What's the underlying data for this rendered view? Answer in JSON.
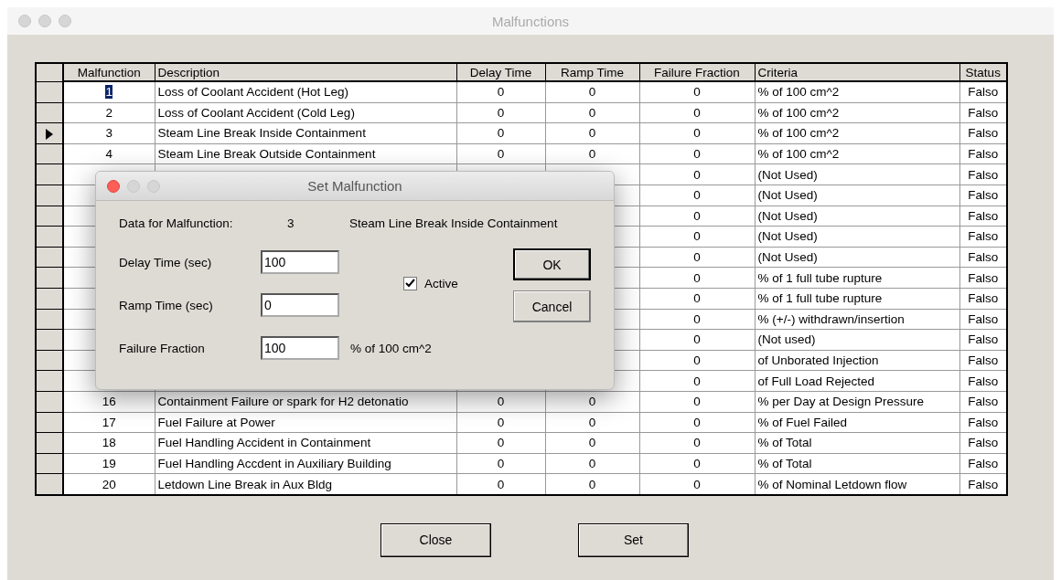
{
  "window": {
    "title": "Malfunctions"
  },
  "table": {
    "columns": [
      "Malfunction",
      "Description",
      "Delay Time",
      "Ramp Time",
      "Failure Fraction",
      "Criteria",
      "Status"
    ],
    "rows": [
      {
        "selected": false,
        "text_highlighted": true,
        "malfunction": "1",
        "description": "Loss of Coolant Accident (Hot Leg)",
        "delay_time": "0",
        "ramp_time": "0",
        "failure_fraction": "0",
        "criteria": "% of 100 cm^2",
        "status": "Falso"
      },
      {
        "selected": false,
        "text_highlighted": false,
        "malfunction": "2",
        "description": "Loss of Coolant Accident (Cold Leg)",
        "delay_time": "0",
        "ramp_time": "0",
        "failure_fraction": "0",
        "criteria": "% of 100 cm^2",
        "status": "Falso"
      },
      {
        "selected": true,
        "text_highlighted": false,
        "malfunction": "3",
        "description": "Steam Line Break Inside Containment",
        "delay_time": "0",
        "ramp_time": "0",
        "failure_fraction": "0",
        "criteria": "% of 100 cm^2",
        "status": "Falso"
      },
      {
        "selected": false,
        "text_highlighted": false,
        "malfunction": "4",
        "description": "Steam Line Break Outside Containment",
        "delay_time": "0",
        "ramp_time": "0",
        "failure_fraction": "0",
        "criteria": "% of 100 cm^2",
        "status": "Falso"
      },
      {
        "selected": false,
        "text_highlighted": false,
        "failure_fraction": "0",
        "criteria": "(Not Used)",
        "status": "Falso"
      },
      {
        "selected": false,
        "text_highlighted": false,
        "failure_fraction": "0",
        "criteria": "(Not Used)",
        "status": "Falso"
      },
      {
        "selected": false,
        "text_highlighted": false,
        "failure_fraction": "0",
        "criteria": "(Not Used)",
        "status": "Falso"
      },
      {
        "selected": false,
        "text_highlighted": false,
        "failure_fraction": "0",
        "criteria": "(Not Used)",
        "status": "Falso"
      },
      {
        "selected": false,
        "text_highlighted": false,
        "failure_fraction": "0",
        "criteria": "(Not Used)",
        "status": "Falso"
      },
      {
        "selected": false,
        "text_highlighted": false,
        "failure_fraction": "0",
        "criteria": "% of 1 full tube rupture",
        "status": "Falso"
      },
      {
        "selected": false,
        "text_highlighted": false,
        "failure_fraction": "0",
        "criteria": "% of 1 full tube rupture",
        "status": "Falso"
      },
      {
        "selected": false,
        "text_highlighted": false,
        "failure_fraction": "0",
        "criteria": "% (+/-) withdrawn/insertion",
        "status": "Falso"
      },
      {
        "selected": false,
        "text_highlighted": false,
        "failure_fraction": "0",
        "criteria": "(Not used)",
        "status": "Falso"
      },
      {
        "selected": false,
        "text_highlighted": false,
        "failure_fraction": "0",
        "criteria": "of Unborated Injection",
        "status": "Falso"
      },
      {
        "selected": false,
        "text_highlighted": false,
        "failure_fraction": "0",
        "criteria": "of Full Load Rejected",
        "status": "Falso"
      },
      {
        "selected": false,
        "text_highlighted": false,
        "malfunction": "16",
        "description": "Containment Failure or spark for H2 detonatio",
        "delay_time": "0",
        "ramp_time": "0",
        "failure_fraction": "0",
        "criteria": "% per Day at Design Pressure",
        "status": "Falso"
      },
      {
        "selected": false,
        "text_highlighted": false,
        "malfunction": "17",
        "description": "Fuel Failure at Power",
        "delay_time": "0",
        "ramp_time": "0",
        "failure_fraction": "0",
        "criteria": "% of Fuel Failed",
        "status": "Falso"
      },
      {
        "selected": false,
        "text_highlighted": false,
        "malfunction": "18",
        "description": "Fuel Handling Accident in Containment",
        "delay_time": "0",
        "ramp_time": "0",
        "failure_fraction": "0",
        "criteria": "% of Total",
        "status": "Falso"
      },
      {
        "selected": false,
        "text_highlighted": false,
        "malfunction": "19",
        "description": "Fuel Handling Accdent in Auxiliary Building",
        "delay_time": "0",
        "ramp_time": "0",
        "failure_fraction": "0",
        "criteria": "% of Total",
        "status": "Falso"
      },
      {
        "selected": false,
        "text_highlighted": false,
        "malfunction": "20",
        "description": "Letdown Line Break in Aux Bldg",
        "delay_time": "0",
        "ramp_time": "0",
        "failure_fraction": "0",
        "criteria": "% of Nominal Letdown flow",
        "status": "Falso"
      }
    ]
  },
  "dialog": {
    "title": "Set Malfunction",
    "data_label": "Data for Malfunction:",
    "data_number": "3",
    "data_description": "Steam Line Break Inside Containment",
    "fields": [
      {
        "label": "Delay Time (sec)",
        "value": "100"
      },
      {
        "label": "Ramp Time (sec)",
        "value": "0"
      },
      {
        "label": "Failure Fraction",
        "value": "100",
        "unit": "% of 100 cm^2"
      }
    ],
    "active": {
      "label": "Active",
      "checked": true
    },
    "buttons": [
      "OK",
      "Cancel"
    ]
  },
  "buttons": [
    "Close",
    "Set"
  ]
}
